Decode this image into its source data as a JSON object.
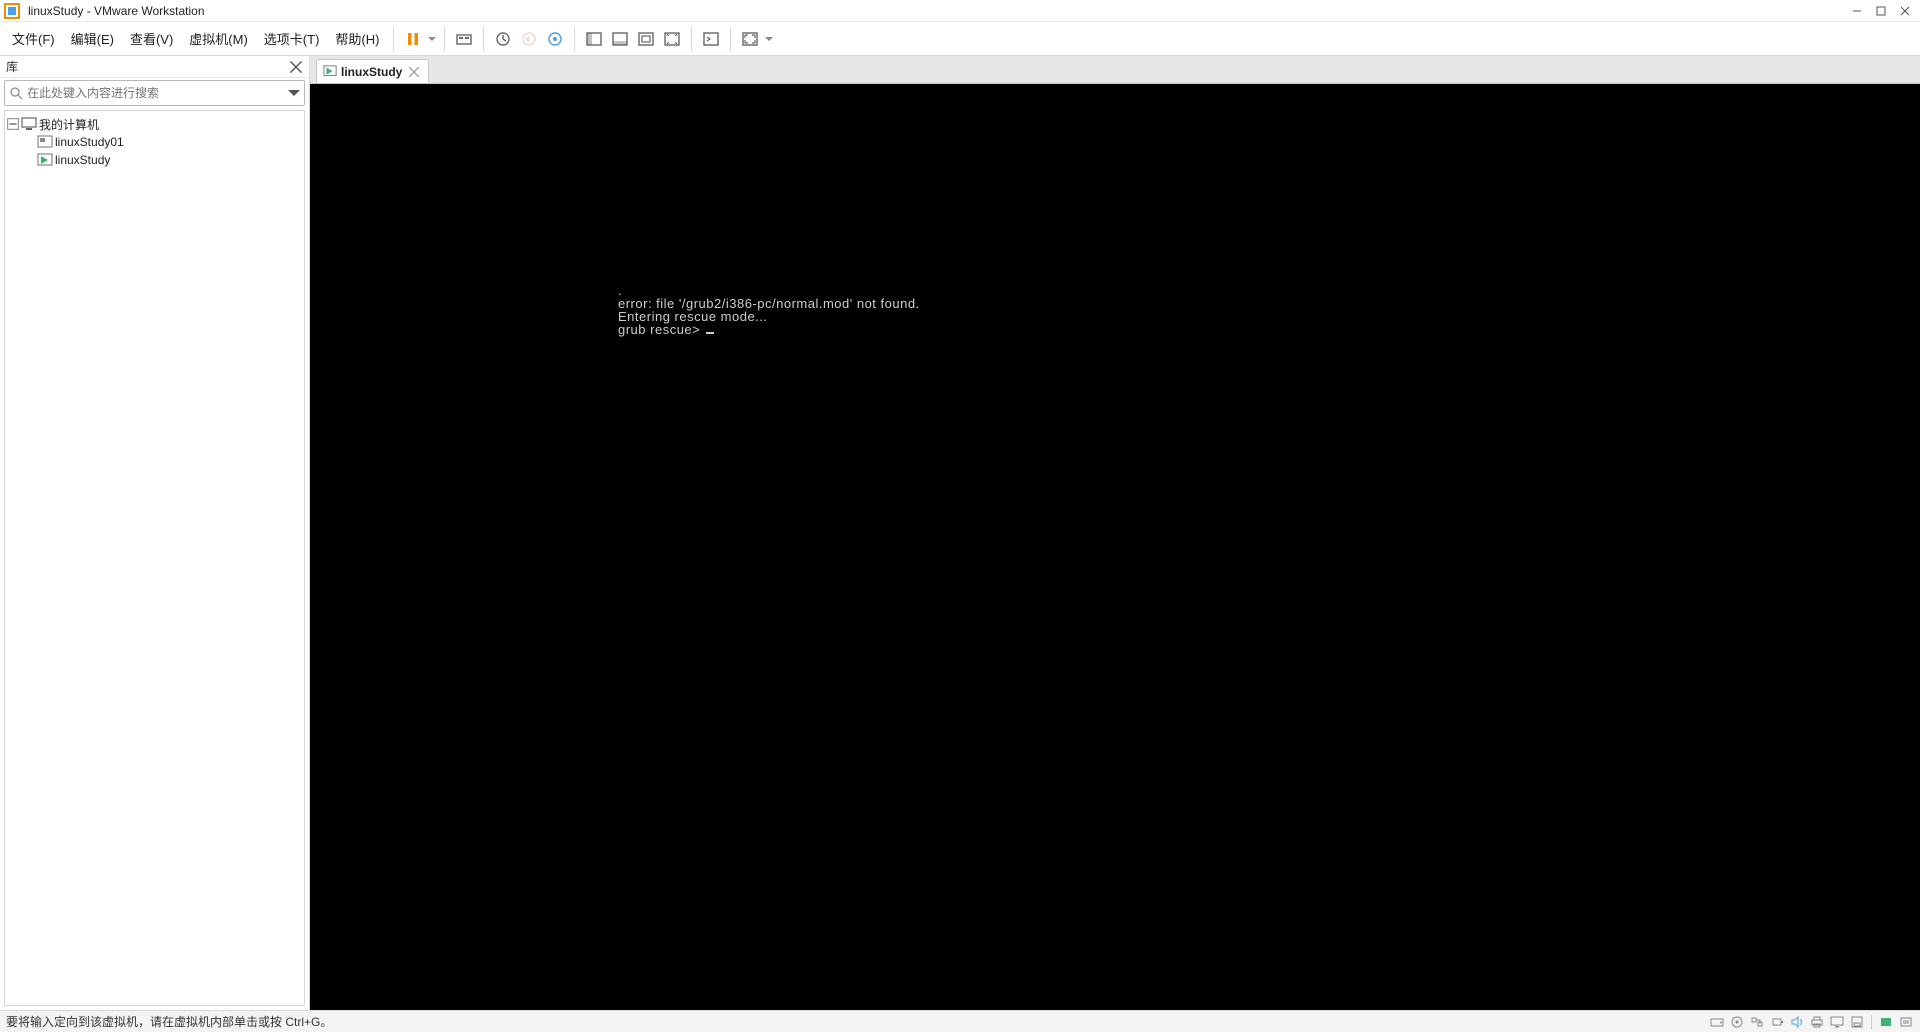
{
  "title": "linuxStudy - VMware Workstation",
  "menu": {
    "items": [
      "文件(F)",
      "编辑(E)",
      "查看(V)",
      "虚拟机(M)",
      "选项卡(T)",
      "帮助(H)"
    ]
  },
  "library": {
    "title": "库",
    "search_placeholder": "在此处键入内容进行搜索",
    "tree_root": "我的计算机",
    "tree_items": [
      "linuxStudy01",
      "linuxStudy"
    ]
  },
  "tab": {
    "label": "linuxStudy"
  },
  "console_lines": [
    ".",
    "error: file '/grub2/i386-pc/normal.mod' not found.",
    "Entering rescue mode...",
    "grub rescue> "
  ],
  "status_message": "要将输入定向到该虚拟机，请在虚拟机内部单击或按 Ctrl+G。"
}
